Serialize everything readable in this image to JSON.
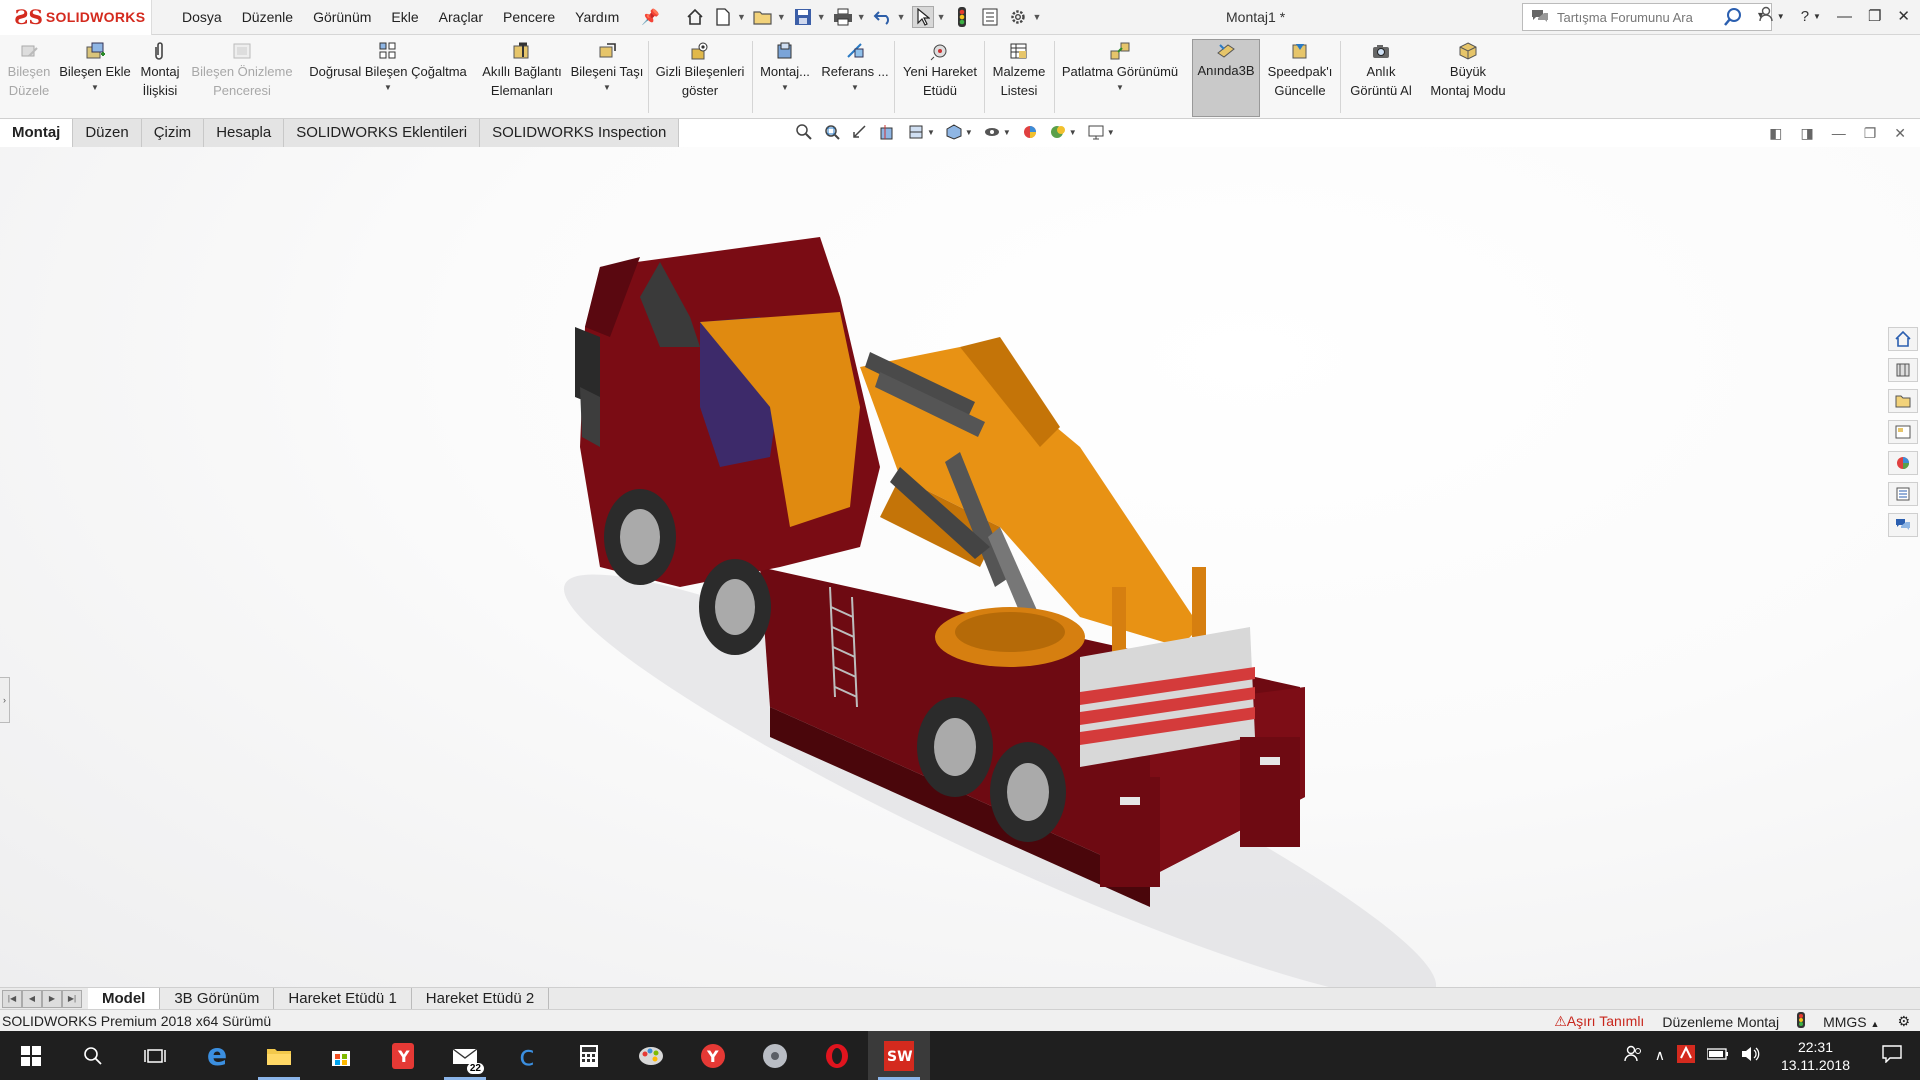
{
  "app": {
    "brand": "SOLIDWORKS",
    "doc_title": "Montaj1 *",
    "menu": [
      "Dosya",
      "Düzenle",
      "Görünüm",
      "Ekle",
      "Araçlar",
      "Pencere",
      "Yardım"
    ],
    "search_placeholder": "Tartışma Forumunu Ara"
  },
  "ribbon": {
    "edit_component": [
      "Bileşen",
      "Düzele"
    ],
    "insert_component": "Bileşen Ekle",
    "mate": [
      "Montaj",
      "İlişkisi"
    ],
    "component_preview": [
      "Bileşen Önizleme",
      "Penceresi"
    ],
    "linear_pattern": "Doğrusal Bileşen Çoğaltma",
    "smart_fasteners": [
      "Akıllı Bağlantı",
      "Elemanları"
    ],
    "move_component": "Bileşeni Taşı",
    "show_hidden": [
      "Gizli Bileşenleri",
      "göster"
    ],
    "assembly_features": "Montaj...",
    "reference": "Referans ...",
    "new_motion_study": [
      "Yeni Hareket",
      "Etüdü"
    ],
    "bom": [
      "Malzeme",
      "Listesi"
    ],
    "exploded_view": "Patlatma Görünümü",
    "instant3d": "Anında3B",
    "speedpak": [
      "Speedpak'ı",
      "Güncelle"
    ],
    "snapshot": [
      "Anlık",
      "Görüntü Al"
    ],
    "large_assembly": [
      "Büyük",
      "Montaj Modu"
    ]
  },
  "tabs": [
    "Montaj",
    "Düzen",
    "Çizim",
    "Hesapla",
    "SOLIDWORKS Eklentileri",
    "SOLIDWORKS Inspection"
  ],
  "active_tab": "Montaj",
  "bottom_tabs": [
    "Model",
    "3B Görünüm",
    "Hareket Etüdü 1",
    "Hareket Etüdü 2"
  ],
  "status": {
    "version": "SOLIDWORKS Premium 2018 x64 Sürümü",
    "overdefined": "Aşırı Tanımlı",
    "mode": "Düzenleme Montaj",
    "units": "MMGS"
  },
  "taskbar": {
    "mail_badge": "22",
    "time": "22:31",
    "date": "13.11.2018"
  },
  "colors": {
    "truck_body": "#7a0c14",
    "crane": "#e08a10",
    "brand_red": "#d42a1e"
  }
}
